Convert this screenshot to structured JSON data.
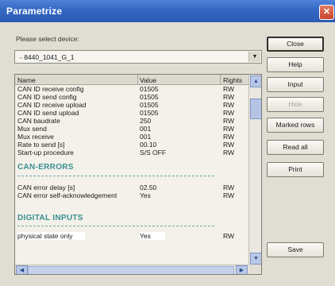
{
  "window": {
    "title": "Parametrize",
    "close_glyph": "✕"
  },
  "device": {
    "label": "Please select device:",
    "selected": "- 8440_1041_G_1"
  },
  "list": {
    "columns": [
      "Name",
      "Value",
      "Rights"
    ],
    "rows": [
      {
        "name": "CAN ID receive config",
        "value": "01505",
        "rights": "RW"
      },
      {
        "name": "CAN ID send config",
        "value": "01505",
        "rights": "RW"
      },
      {
        "name": "CAN ID receive upload",
        "value": "01505",
        "rights": "RW"
      },
      {
        "name": "CAN ID send upload",
        "value": "01505",
        "rights": "RW"
      },
      {
        "name": "CAN baudrate",
        "value": "250",
        "rights": "RW"
      },
      {
        "name": "Mux send",
        "value": "001",
        "rights": "RW"
      },
      {
        "name": "Mux receive",
        "value": "001",
        "rights": "RW"
      },
      {
        "name": "Rate to send [s]",
        "value": "00.10",
        "rights": "RW"
      },
      {
        "name": "Start-up procedure",
        "value": "S/S OFF",
        "rights": "RW"
      }
    ],
    "section_errors": "CAN-ERRORS",
    "error_rows": [
      {
        "name": "CAN error delay [s]",
        "value": "02.50",
        "rights": "RW"
      },
      {
        "name": "CAN error self-acknowledgement",
        "value": "Yes",
        "rights": "RW"
      }
    ],
    "section_inputs": "DIGITAL INPUTS",
    "input_rows": [
      {
        "name": "physical state only",
        "value": "Yes",
        "rights": "RW"
      }
    ]
  },
  "buttons": {
    "close": "Close",
    "help": "Help",
    "input": "Input",
    "hidden": "Hide",
    "marked_rows": "Marked rows",
    "read_all": "Read all",
    "print": "Print",
    "save": "Save"
  },
  "icons": {
    "dropdown": "▼",
    "scroll_up": "▲",
    "scroll_down": "▼",
    "scroll_left": "◀",
    "scroll_right": "▶"
  }
}
